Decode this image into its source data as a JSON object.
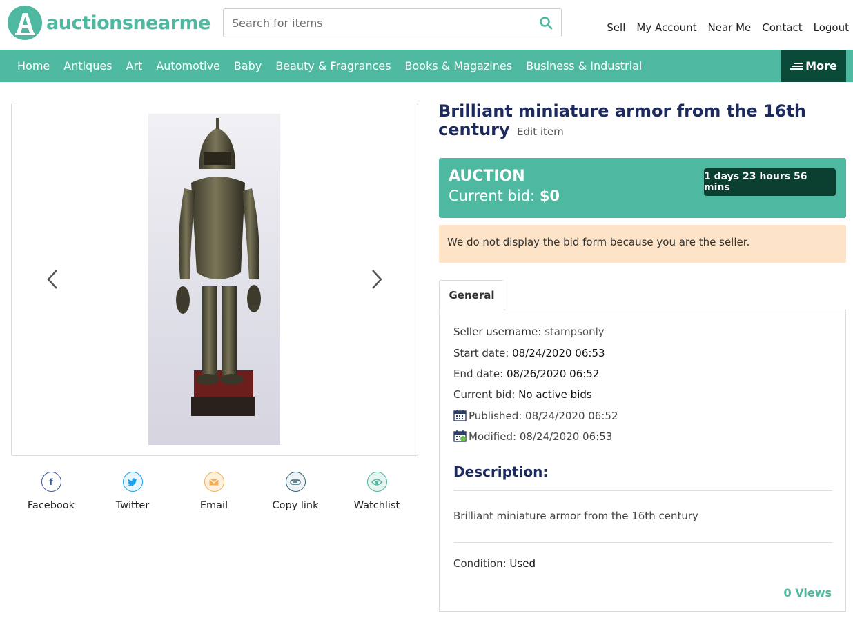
{
  "brand": {
    "name": "auctionsnearme",
    "color": "#4fb8a0"
  },
  "search": {
    "placeholder": "Search for items",
    "icon": "search-icon"
  },
  "top_links": [
    "Sell",
    "My Account",
    "Near Me",
    "Contact",
    "Logout"
  ],
  "nav": {
    "items": [
      "Home",
      "Antiques",
      "Art",
      "Automotive",
      "Baby",
      "Beauty & Fragrances",
      "Books & Magazines",
      "Business & Industrial"
    ],
    "more_label": "More"
  },
  "item": {
    "title": "Brilliant miniature armor from the 16th century",
    "edit_label": "Edit item"
  },
  "bid": {
    "type_label": "AUCTION",
    "current_label": "Current bid:",
    "current_value": "$0",
    "countdown": "1 days 23 hours 56 mins"
  },
  "notice": "We do not display the bid form because you are the seller.",
  "tab": {
    "label": "General"
  },
  "details": {
    "seller_label": "Seller username:",
    "seller_value": "stampsonly",
    "start_label": "Start date:",
    "start_value": "08/24/2020 06:53",
    "end_label": "End date:",
    "end_value": "08/26/2020 06:52",
    "bid_label": "Current bid:",
    "bid_value": "No active bids",
    "published_label": "Published: 08/24/2020 06:52",
    "modified_label": "Modified: 08/24/2020 06:53"
  },
  "description": {
    "heading": "Description:",
    "text": "Brilliant miniature armor from the 16th century",
    "condition_label": "Condition:",
    "condition_value": "Used"
  },
  "views": "0 Views",
  "share": [
    {
      "label": "Facebook",
      "icon": "facebook-icon",
      "color": "#3b5998"
    },
    {
      "label": "Twitter",
      "icon": "twitter-icon",
      "color": "#1da1f2"
    },
    {
      "label": "Email",
      "icon": "email-icon",
      "color": "#f0b05a"
    },
    {
      "label": "Copy link",
      "icon": "link-icon",
      "color": "#3a6478"
    },
    {
      "label": "Watchlist",
      "icon": "eye-icon",
      "color": "#4fb8a0"
    }
  ],
  "colors": {
    "accent": "#4fb8a0",
    "dark_green": "#0b4a38",
    "title_navy": "#1d2a5c",
    "notice_bg": "#fde4c8"
  }
}
